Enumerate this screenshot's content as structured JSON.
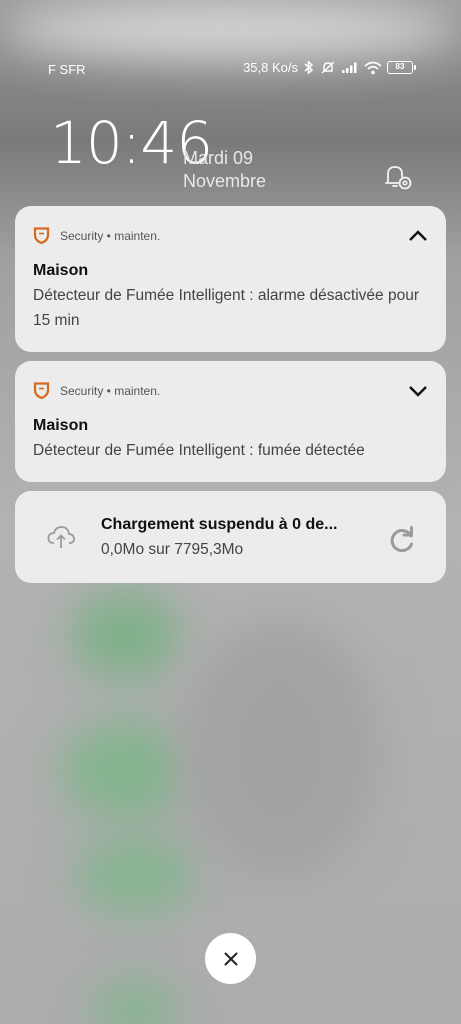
{
  "status_bar": {
    "carrier": "F SFR",
    "net_speed": "35,8 Ko/s",
    "battery_level": "83"
  },
  "lockscreen": {
    "time": "10:46",
    "day": "Mardi 09",
    "month": "Novembre"
  },
  "notifications": [
    {
      "app_line": "Security • mainten.",
      "title": "Maison",
      "text": "Détecteur de Fumée Intelligent : alarme désactivée pour 15 min",
      "expanded": true
    },
    {
      "app_line": "Security • mainten.",
      "title": "Maison",
      "text": "Détecteur de Fumée Intelligent : fumée détectée",
      "expanded": false
    }
  ],
  "download": {
    "title": "Chargement suspendu à 0 de...",
    "progress_text": "0,0Mo sur 7795,3Mo"
  },
  "icons": {
    "app": "shield-icon",
    "settings": "bell-gear-icon",
    "download": "cloud-upload-icon",
    "retry": "refresh-icon",
    "close": "close-icon"
  },
  "colors": {
    "app_accent": "#d9691f",
    "card_bg": "#ececec"
  }
}
